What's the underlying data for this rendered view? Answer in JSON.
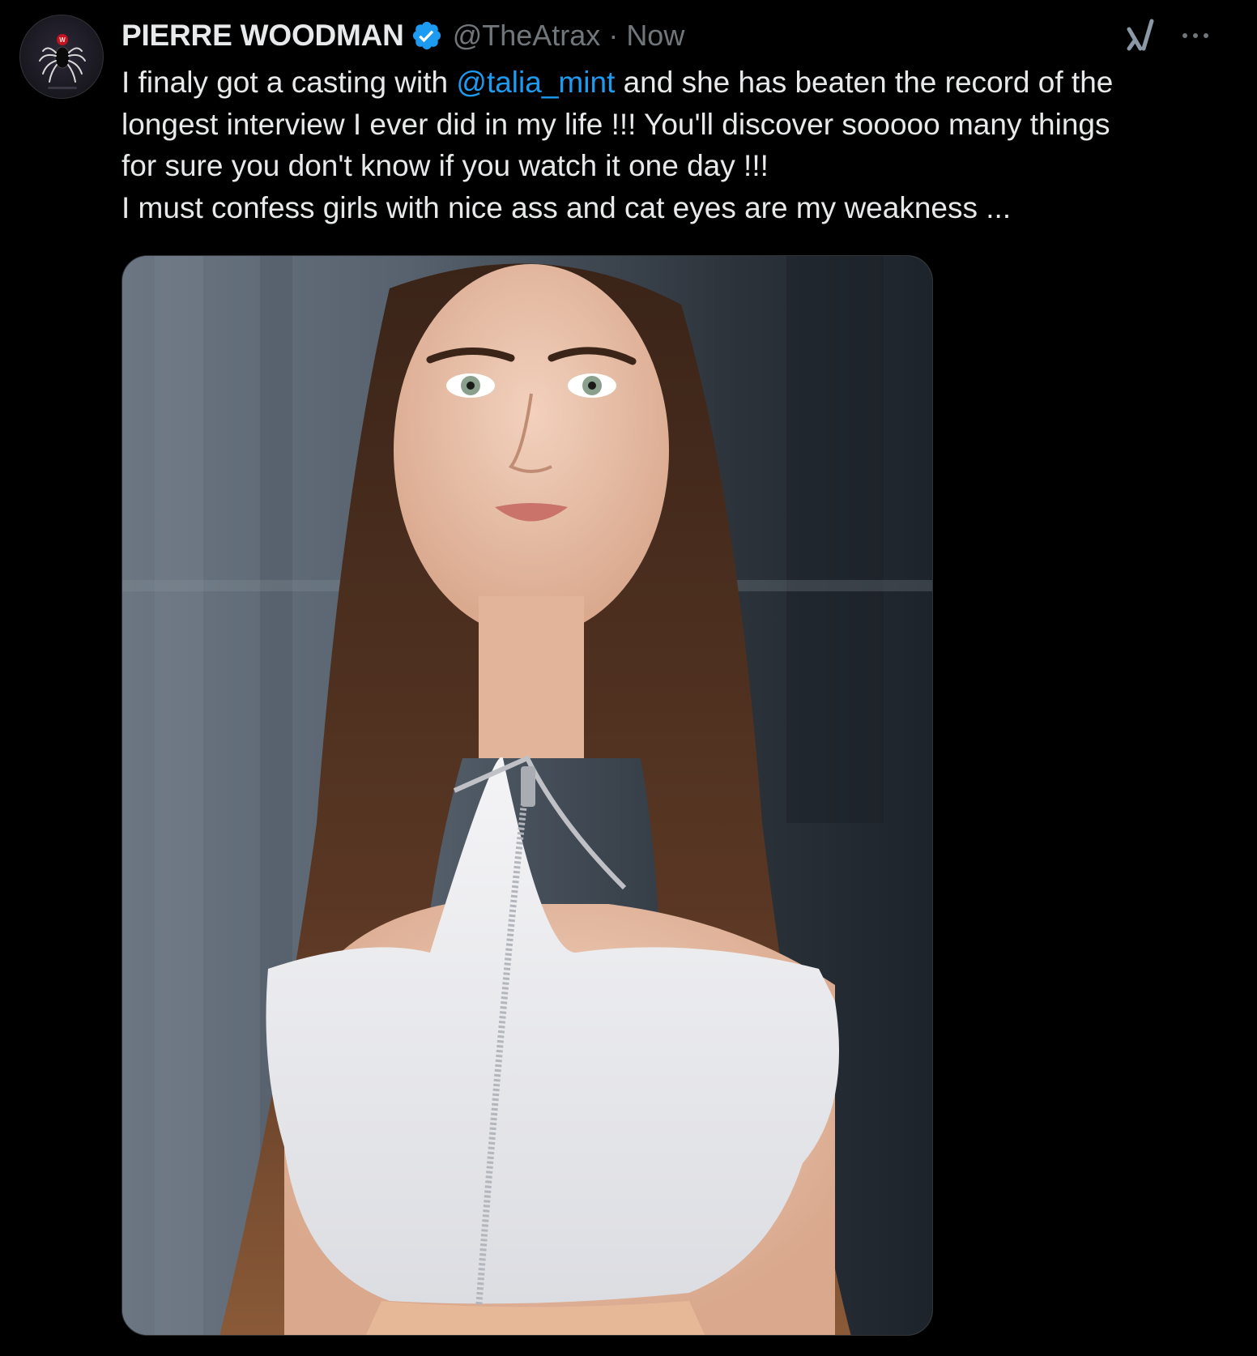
{
  "author": {
    "display_name": "PIERRE WOODMAN",
    "handle": "@TheAtrax",
    "separator": "·",
    "timestamp": "Now",
    "verified": true,
    "avatar_icon": "spider-logo-icon"
  },
  "actions": {
    "grok_icon": "grok-icon",
    "more_icon": "more-options-icon"
  },
  "tweet": {
    "line1_before": "I finaly got a casting with ",
    "mention": "@talia_mint",
    "line1_after": "  and she has beaten the record of the",
    "line2": "longest interview I ever did in my life !!! You'll discover sooooo many things",
    "line3": "for sure you don't know if you watch it one day !!!",
    "line4": "I must confess girls with nice ass and cat eyes are my weakness ..."
  },
  "media": {
    "type": "photo"
  },
  "colors": {
    "background": "#000000",
    "text": "#e7e9ea",
    "secondary": "#71767b",
    "link": "#1d9bf0",
    "border": "#2f3336"
  }
}
